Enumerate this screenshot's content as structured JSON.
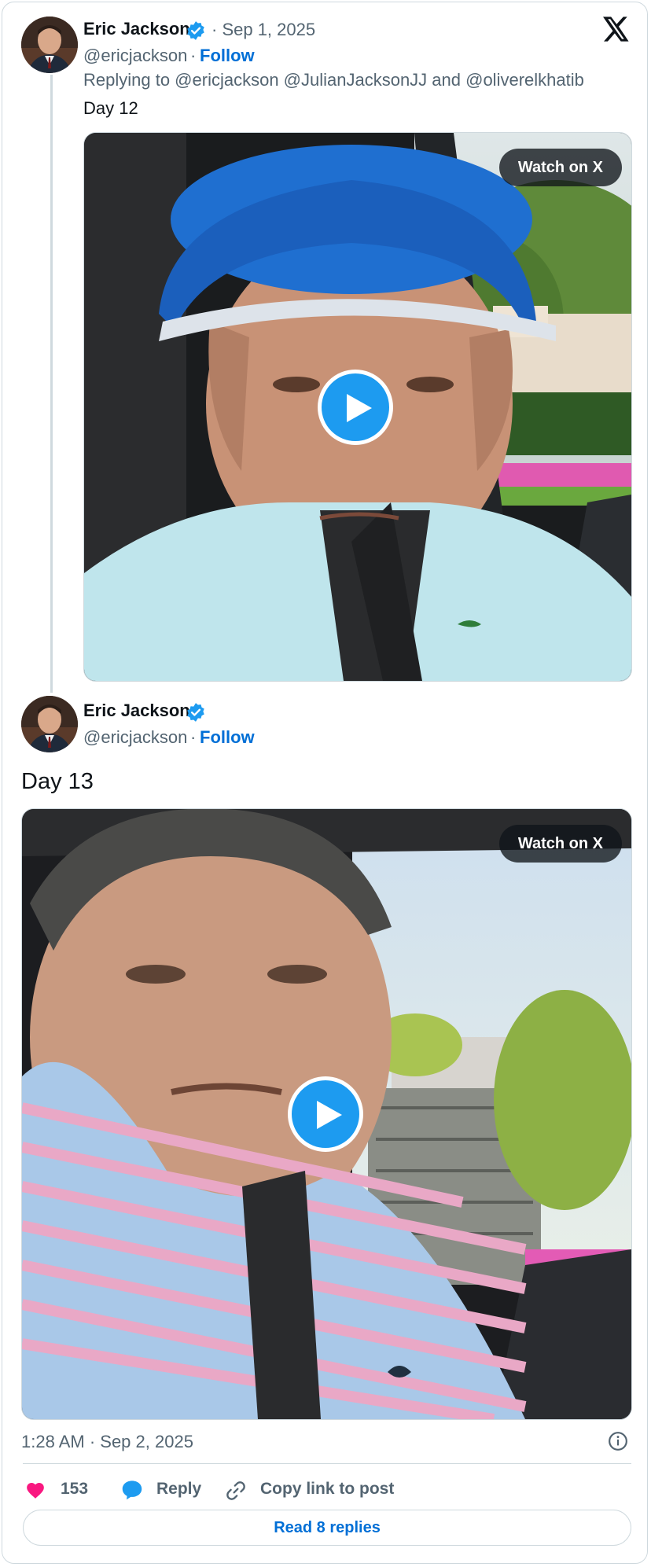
{
  "reply_tweet": {
    "author_name": "Eric Jackson",
    "separator_date": "· Sep 1, 2025",
    "handle": "@ericjackson",
    "dot": "·",
    "follow_label": "Follow",
    "replying_to": "Replying to @ericjackson @JulianJacksonJJ and @oliverelkhatib",
    "text": "Day 12",
    "watch_label": "Watch on X"
  },
  "main_tweet": {
    "author_name": "Eric Jackson",
    "handle": "@ericjackson",
    "dot": "·",
    "follow_label": "Follow",
    "text": "Day 13",
    "watch_label": "Watch on X",
    "timestamp": "1:28 AM · Sep 2, 2025"
  },
  "actions": {
    "like_count": "153",
    "reply_label": "Reply",
    "copy_label": "Copy link to post"
  },
  "read_replies_label": "Read 8 replies",
  "colors": {
    "accent": "#1d9bf0",
    "follow": "#006fd6",
    "like": "#f91880",
    "border": "#cfd9de"
  },
  "icons": [
    "x-logo-icon",
    "verified-badge-icon",
    "play-icon",
    "heart-icon",
    "reply-bubble-icon",
    "link-icon",
    "info-icon"
  ]
}
